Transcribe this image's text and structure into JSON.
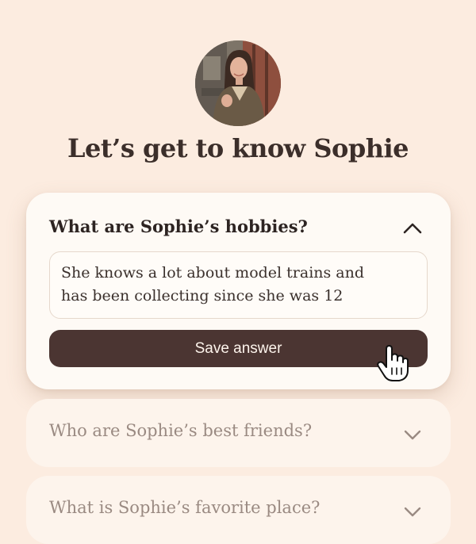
{
  "page": {
    "title": "Let’s get to know Sophie"
  },
  "avatar": {
    "alt": "Sophie profile photo"
  },
  "questions": [
    {
      "label": "What are Sophie’s hobbies?",
      "state": "expanded",
      "answer": "She knows a lot about model trains and\nhas been collecting since she was 12",
      "save_label": "Save answer",
      "chevron_icon": "chevron-up-icon"
    },
    {
      "label": "Who are Sophie’s best friends?",
      "state": "collapsed",
      "chevron_icon": "chevron-down-icon"
    },
    {
      "label": "What is Sophie’s favorite place?",
      "state": "collapsed",
      "chevron_icon": "chevron-down-icon"
    }
  ],
  "colors": {
    "background": "#fcece0",
    "button": "#4b3532",
    "text": "#3b2e2a",
    "muted_text": "#9a8a82"
  },
  "cursor_icon": "hand-pointer-icon"
}
